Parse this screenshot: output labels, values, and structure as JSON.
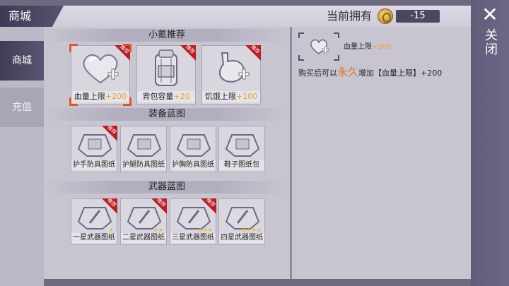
{
  "header": {
    "title": "商城",
    "owned_label": "当前拥有",
    "currency_amount": "-15",
    "coin_icon": "gold-coin-icon"
  },
  "close": {
    "icon": "close-icon",
    "label": "关闭"
  },
  "tabs": [
    {
      "label": "商城",
      "selected": true
    },
    {
      "label": "充值",
      "selected": false
    }
  ],
  "sections": [
    {
      "title": "小氪推荐",
      "items": [
        {
          "name": "血量上限",
          "bonus": "+200",
          "icon": "heart-plus-icon",
          "badge": "推荐",
          "selected": true
        },
        {
          "name": "背包容量",
          "bonus": "+20",
          "icon": "backpack-icon",
          "badge": "推荐",
          "selected": false
        },
        {
          "name": "饥饿上限",
          "bonus": "+100",
          "icon": "stomach-plus-icon",
          "badge": "推荐",
          "selected": false
        }
      ]
    },
    {
      "title": "装备蓝图",
      "items": [
        {
          "name": "护手防具图纸",
          "icon": "blueprint-bundle-icon",
          "badge": "推荐"
        },
        {
          "name": "护腿防具图纸",
          "icon": "blueprint-bundle-icon",
          "badge": ""
        },
        {
          "name": "护胸防具图纸",
          "icon": "blueprint-bundle-icon",
          "badge": ""
        },
        {
          "name": "鞋子图纸包",
          "icon": "blueprint-bundle-icon",
          "badge": ""
        }
      ]
    },
    {
      "title": "武器蓝图",
      "items": [
        {
          "name": "一星武器图纸",
          "icon": "weapon-blueprint-icon",
          "badge": "推荐",
          "stars": 1
        },
        {
          "name": "二星武器图纸",
          "icon": "weapon-blueprint-icon",
          "badge": "推荐",
          "stars": 2
        },
        {
          "name": "三星武器图纸",
          "icon": "weapon-blueprint-icon",
          "badge": "推荐",
          "stars": 3
        },
        {
          "name": "四星武器图纸",
          "icon": "weapon-blueprint-icon",
          "badge": "",
          "stars": 4
        }
      ]
    }
  ],
  "detail": {
    "icon": "heart-plus-icon",
    "name": "血量上限",
    "bonus": "+200",
    "desc_prefix": "购买后可以",
    "desc_highlight": "永久",
    "desc_suffix": "增加【血量上限】+200"
  },
  "colors": {
    "accent_orange": "#e8a13a",
    "selection_frame": "#e0542b",
    "badge_red": "#b81f24",
    "sidebar_dark": "#3f3c55"
  }
}
